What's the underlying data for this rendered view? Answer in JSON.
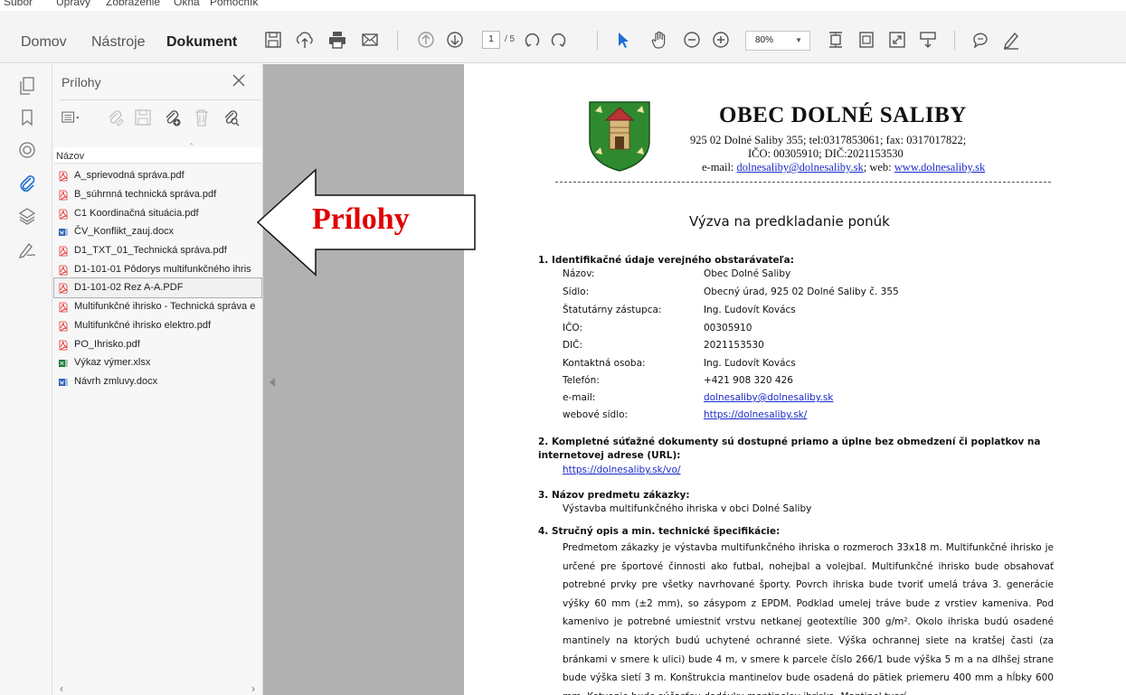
{
  "menu": {
    "items": [
      "Súbor",
      "Úpravy",
      "Zobrazenie",
      "Okná",
      "Pomocník"
    ]
  },
  "nav": {
    "home": "Domov",
    "tools": "Nástroje",
    "document": "Dokument"
  },
  "toolbar": {
    "page_current": "1",
    "page_total": "/ 5",
    "zoom": "80%",
    "icons": [
      "save-icon",
      "upload-icon",
      "print-icon",
      "email-icon",
      "page-up-icon",
      "page-down-icon",
      "rotate-left-icon",
      "rotate-right-icon",
      "select-cursor-icon",
      "hand-icon",
      "zoom-out-icon",
      "zoom-in-icon",
      "fit-page-icon",
      "fit-width-icon",
      "fullscreen-icon",
      "scroll-mode-icon",
      "comment-icon",
      "highlight-pen-icon"
    ]
  },
  "rail": {
    "icons": [
      "pages-icon",
      "bookmark-icon",
      "layers-target-icon",
      "paperclip-icon",
      "layers-icon",
      "signature-icon"
    ]
  },
  "panel": {
    "title": "Prílohy",
    "column_header": "Názov",
    "files": [
      {
        "name": "A_sprievodná správa.pdf",
        "type": "pdf"
      },
      {
        "name": "B_súhrnná technická správa.pdf",
        "type": "pdf"
      },
      {
        "name": "C1 Koordinačná situácia.pdf",
        "type": "pdf"
      },
      {
        "name": "ČV_Konflikt_zauj.docx",
        "type": "docx"
      },
      {
        "name": "D1_TXT_01_Technická správa.pdf",
        "type": "pdf"
      },
      {
        "name": "D1-101-01 Pôdorys multifunkčného ihris",
        "type": "pdf"
      },
      {
        "name": "D1-101-02 Rez A-A.PDF",
        "type": "pdf",
        "selected": true
      },
      {
        "name": "Multifunkčné ihrisko - Technická správa e",
        "type": "pdf"
      },
      {
        "name": "Multifunkčné ihrisko elektro.pdf",
        "type": "pdf"
      },
      {
        "name": "PO_Ihrisko.pdf",
        "type": "pdf"
      },
      {
        "name": "Výkaz výmer.xlsx",
        "type": "xlsx"
      },
      {
        "name": "Návrh zmluvy.docx",
        "type": "docx"
      }
    ]
  },
  "callout": {
    "text": "Prílohy",
    "color": "#e00000"
  },
  "doc": {
    "org_name": "OBEC DOLNÉ   SALIBY",
    "address_line": "925 02 Dolné Saliby 355; tel:0317853061; fax: 0317017822;",
    "ids_line": "IČO: 00305910;  DIČ:2021153530",
    "email_prefix": "e-mail: ",
    "email": "dolnesaliby@dolnesaliby.sk",
    "web_prefix": "; web: ",
    "web": "www.dolnesaliby.sk",
    "title": "Výzva na predkladanie ponúk",
    "section1": "1.  Identifikačné údaje verejného obstarávateľa:",
    "fields": [
      {
        "label": "Názov:",
        "value": "Obec Dolné Saliby"
      },
      {
        "label": "Sídlo:",
        "value": "Obecný úrad, 925 02 Dolné Saliby č. 355"
      },
      {
        "label": "Štatutárny zástupca:",
        "value": "Ing. Ľudovít Kovács"
      },
      {
        "label": "IČO:",
        "value": "00305910"
      },
      {
        "label": "DIČ:",
        "value": "2021153530"
      },
      {
        "label": "Kontaktná osoba:",
        "value": "Ing. Ľudovít Kovács"
      },
      {
        "label": "Telefón:",
        "value": "+421 908 320 426"
      },
      {
        "label": "e-mail:",
        "value": "dolnesaliby@dolnesaliby.sk"
      },
      {
        "label": "webové sídlo:",
        "value": "https://dolnesaliby.sk/"
      }
    ],
    "section2": "2.  Kompletné súťažné dokumenty sú dostupné priamo a úplne bez obmedzení či poplatkov na internetovej adrese (URL):",
    "section2_link": "https://dolnesaliby.sk/vo/",
    "section3": "3.  Názov predmetu zákazky:",
    "section3_text": "Výstavba multifunkčného ihriska v obci Dolné Saliby",
    "section4": "4.  Stručný opis a min. technické špecifikácie:",
    "section4_text": "Predmetom zákazky je výstavba multifunkčného ihriska o rozmeroch 33x18 m. Multifunkčné ihrisko je určené pre športové činnosti ako futbal, nohejbal a volejbal. Multifunkčné ihrisko bude obsahovať potrebné prvky pre všetky navrhované športy. Povrch ihriska bude tvoriť umelá tráva 3. generácie výšky 60 mm (±2 mm), so zásypom z EPDM. Podklad umelej tráve bude z vrstiev kameniva. Pod kamenivo je potrebné umiestniť vrstvu netkanej geotextílie 300 g/m². Okolo ihriska budú osadené mantinely na ktorých budú uchytené ochranné siete. Výška ochrannej siete na kratšej časti (za bránkami v smere k ulici) bude 4 m, v smere k parcele číslo 266/1 bude výška 5 m a na dlhšej strane bude výška sietí 3 m. Konštrukcia mantinelov bude osadená do pätiek priemeru 400 mm a hĺbky 600 mm. Kotvenie bude súčasťou dodávky mantinelov ihriska. Mantinel tvorí"
  }
}
